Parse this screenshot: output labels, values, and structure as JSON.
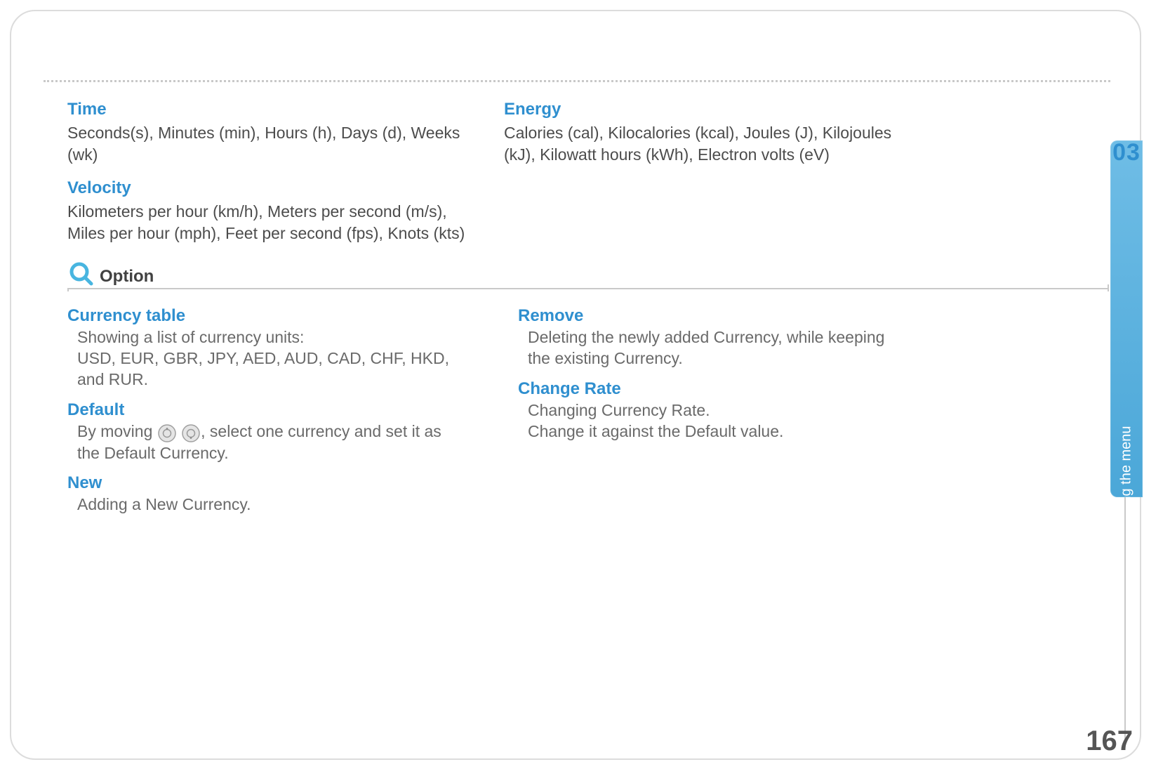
{
  "units": {
    "time": {
      "heading": "Time",
      "body": "Seconds(s), Minutes (min), Hours (h), Days (d), Weeks (wk)"
    },
    "velocity": {
      "heading": "Velocity",
      "body": "Kilometers per hour (km/h), Meters per second (m/s), Miles per hour (mph), Feet per second (fps), Knots (kts)"
    },
    "energy": {
      "heading": "Energy",
      "body": "Calories (cal), Kilocalories (kcal), Joules (J), Kilojoules (kJ), Kilowatt hours (kWh), Electron volts (eV)"
    }
  },
  "option_section": {
    "label": "Option"
  },
  "options": {
    "currency_table": {
      "heading": "Currency table",
      "body": "Showing a list of currency units:\nUSD, EUR, GBR, JPY, AED, AUD, CAD, CHF, HKD, and RUR."
    },
    "default": {
      "heading": "Default",
      "body_pre": "By moving ",
      "body_post": ", select one currency and set it as the Default Currency."
    },
    "new": {
      "heading": "New",
      "body": "Adding a New Currency."
    },
    "remove": {
      "heading": "Remove",
      "body": "Deleting the newly added Currency, while keeping the existing Currency."
    },
    "change_rate": {
      "heading": "Change Rate",
      "body": "Changing Currency Rate.\nChange it against the Default value."
    }
  },
  "side_tab": {
    "chapter": "03",
    "label": "Using the menu"
  },
  "page_number": "167"
}
